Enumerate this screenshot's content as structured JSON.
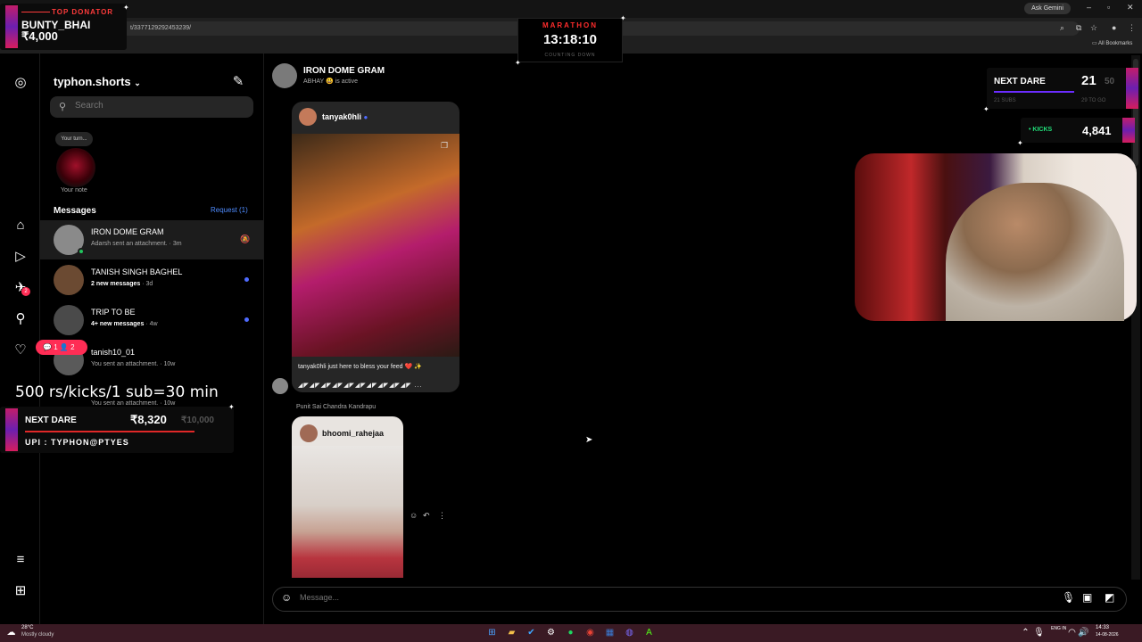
{
  "browser": {
    "url": "t/337712929245323​9/",
    "ask_gemini": "Ask Gemini",
    "all_bookmarks": "All Bookmarks",
    "win_minimize": "–",
    "win_maximize": "▫",
    "win_close": "✕"
  },
  "overlays": {
    "top_donator_label": "TOP DONATOR",
    "top_donator_name": "BUNTY_BHAI",
    "top_donator_amount": "₹4,000",
    "marathon_label": "MARATHON",
    "marathon_time": "13:18:10",
    "marathon_sub": "COUNTING DOWN",
    "next_dare_top_label": "NEXT DARE",
    "next_dare_top_count": "21",
    "next_dare_top_goal": "50",
    "next_dare_top_sub": "21 SUBS",
    "next_dare_top_togo": "29 TO GO",
    "kicks_label": "• KICKS",
    "kicks_count": "4,841",
    "rate_text": "500 rs/kicks/1 sub=30 min",
    "next_dare_left_label": "NEXT DARE",
    "next_dare_left_amount": "₹8,320",
    "next_dare_left_goal": "₹10,000",
    "upi": "UPI : TYPHON@PTYES",
    "notif_comments": "1",
    "notif_follows": "2",
    "accent_pink": "#c21d6a",
    "accent_green": "#22e07a",
    "accent_red": "#ff2c2c"
  },
  "sidebar": {
    "username": "typhon.shorts",
    "search_placeholder": "Search",
    "note_bubble": "Your turn...",
    "note_label": "Your note",
    "messages_heading": "Messages",
    "request_link": "Request (1)",
    "notification_count": "2",
    "conversations": [
      {
        "name": "IRON DOME GRAM",
        "sub": "Adarsh sent an attachment. · 3m",
        "muted": true,
        "online": true,
        "unread": false
      },
      {
        "name": "TANISH SINGH BAGHEL",
        "sub_bold": "2 new messages",
        "sub_tail": " · 3d",
        "unread": true
      },
      {
        "name": "TRIP TO BE",
        "sub_bold": "4+ new messages",
        "sub_tail": " · 4w",
        "unread": true
      },
      {
        "name": "tanish10_01",
        "sub": "You sent an attachment. · 10w",
        "unread": false
      },
      {
        "name": "",
        "sub": "You sent an attachment. · 10w",
        "unread": false
      }
    ]
  },
  "chat": {
    "title": "IRON DOME GRAM",
    "status": "ABHAY 😃 is active",
    "post1_author": "tanyak0hli",
    "post1_caption": "tanyak0hli just here to bless your feed ❤️ ✨",
    "post1_caption2": "◢◤◢◤◢◤◢◤◢◤◢◤◢◤◢◤◢◤◢◤ ...",
    "forward_label": "Punit Sai Chandra Kandrapu",
    "post2_author": "bhoomi_rahejaa",
    "composer_placeholder": "Message..."
  },
  "taskbar": {
    "weather_temp": "28°C",
    "weather_desc": "Mostly cloudy",
    "lang": "ENG IN",
    "time": "14:33",
    "date": "14-08-2026"
  }
}
